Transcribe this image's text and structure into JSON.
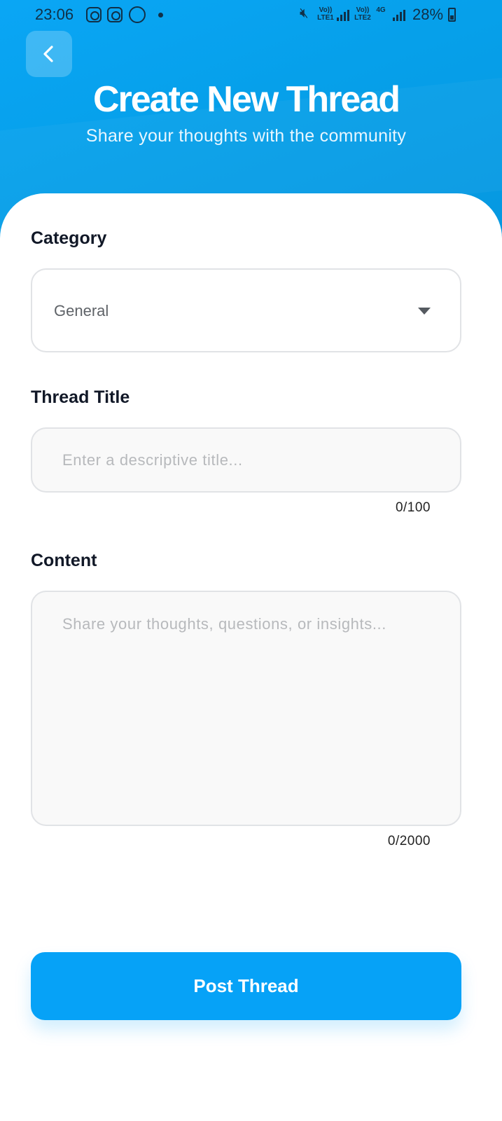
{
  "status_bar": {
    "time": "23:06",
    "sim1": "Vo)) LTE1",
    "sim2": "Vo)) LTE2",
    "network": "4G",
    "battery": "28%",
    "icons": [
      "instagram-icon",
      "instagram-icon",
      "whatsapp-icon",
      "notification-dot",
      "mute-icon",
      "signal-icon",
      "battery-icon"
    ]
  },
  "header": {
    "back_icon": "chevron-left-icon",
    "title": "Create New Thread",
    "subtitle": "Share your thoughts with the community"
  },
  "form": {
    "category": {
      "label": "Category",
      "value": "General"
    },
    "title_field": {
      "label": "Thread Title",
      "value": "",
      "placeholder": "Enter a descriptive title...",
      "counter": "0/100"
    },
    "content_field": {
      "label": "Content",
      "value": "",
      "placeholder": "Share your thoughts, questions, or insights...",
      "counter": "0/2000"
    }
  },
  "submit": {
    "label": "Post Thread"
  },
  "colors": {
    "header_gradient": "#0aa6f5",
    "primary_button": "#06a2f7",
    "label_text": "#111827"
  }
}
